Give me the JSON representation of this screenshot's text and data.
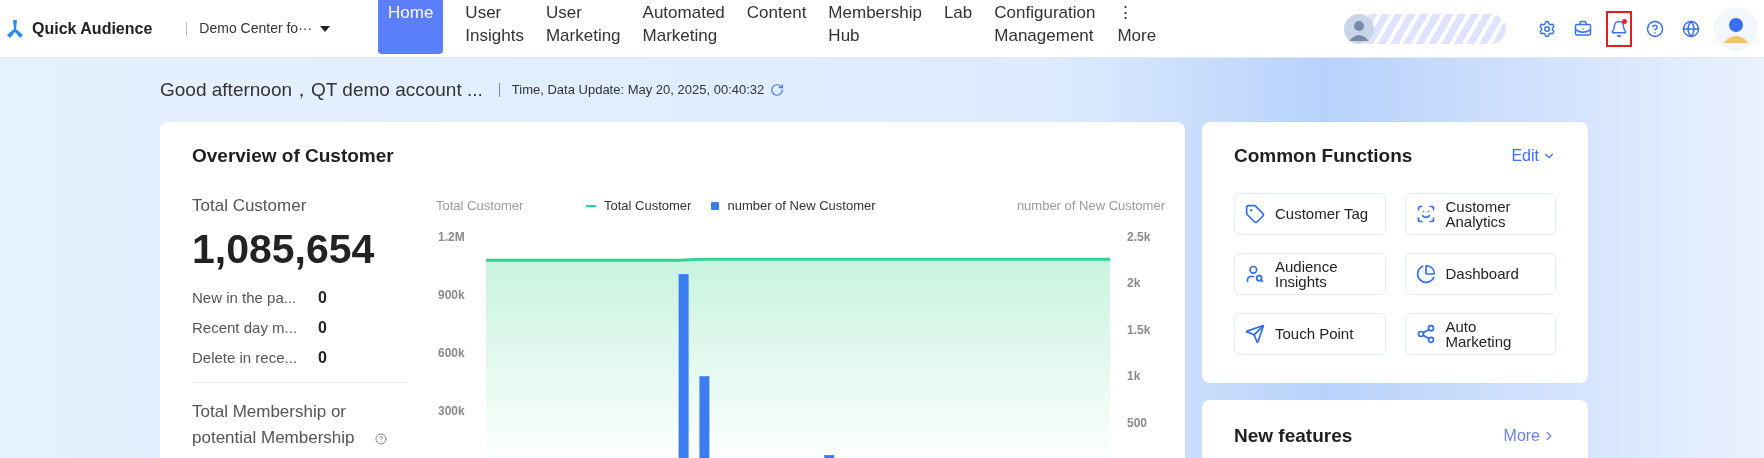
{
  "app": {
    "name": "Quick Audience"
  },
  "workspace": {
    "label": "Demo Center fo···"
  },
  "nav": [
    {
      "label": "Home",
      "selected": true
    },
    {
      "label": "User Insights",
      "selected": false
    },
    {
      "label": "User Marketing",
      "selected": false
    },
    {
      "label": "Automated Marketing",
      "selected": false
    },
    {
      "label": "Content",
      "selected": false
    },
    {
      "label": "Membership Hub",
      "selected": false
    },
    {
      "label": "Lab",
      "selected": false
    },
    {
      "label": "Configuration Management",
      "selected": false
    },
    {
      "label": "More",
      "selected": false,
      "glyph": "⋮"
    }
  ],
  "header_icons": [
    {
      "kind": "settings",
      "highlighted": false,
      "badge": false
    },
    {
      "kind": "briefcase",
      "highlighted": false,
      "badge": false
    },
    {
      "kind": "bell",
      "highlighted": true,
      "badge": true
    },
    {
      "kind": "help",
      "highlighted": false,
      "badge": false
    },
    {
      "kind": "globe",
      "highlighted": false,
      "badge": false
    }
  ],
  "greeting": "Good afternoon，QT demo account ...",
  "update_time": "Time, Data Update: May 20, 2025, 00:40:32",
  "overview": {
    "title": "Overview of Customer",
    "total_label": "Total Customer",
    "total_value": "1,085,654",
    "stats": [
      {
        "label": "New in the pa...",
        "value": "0"
      },
      {
        "label": "Recent day m...",
        "value": "0"
      },
      {
        "label": "Delete in rece...",
        "value": "0"
      }
    ],
    "membership_label": "Total Membership or potential Membership",
    "chart_data": {
      "type": "bar",
      "legend": "top",
      "ylabel": "Total Customer",
      "y2label": "number of New Customer",
      "ylim": [
        0,
        1200000
      ],
      "yticks": [
        {
          "value": 300000,
          "label": "300k"
        },
        {
          "value": 600000,
          "label": "600k"
        },
        {
          "value": 900000,
          "label": "900k"
        },
        {
          "value": 1200000,
          "label": "1.2M"
        }
      ],
      "y2lim": [
        0,
        2500
      ],
      "y2ticks": [
        {
          "value": 500,
          "label": "500"
        },
        {
          "value": 1000,
          "label": "1k"
        },
        {
          "value": 1500,
          "label": "1.5k"
        },
        {
          "value": 2000,
          "label": "2k"
        },
        {
          "value": 2500,
          "label": "2.5k"
        }
      ],
      "series": [
        {
          "name": "Total Customer",
          "color": "#2fd592",
          "type": "line",
          "values": [
            1080000,
            1080000,
            1080000,
            1080000,
            1080000,
            1080000,
            1080000,
            1080000,
            1080000,
            1080000,
            1085000,
            1085000,
            1085000,
            1085000,
            1085000,
            1085000,
            1085000,
            1085000,
            1085000,
            1085000,
            1085000,
            1085000,
            1085000,
            1085000,
            1085000,
            1085000,
            1085000,
            1085000,
            1085000,
            1085000
          ]
        },
        {
          "name": "number of New Customer",
          "color": "#3b7df0",
          "type": "bar",
          "axis": "y2",
          "values": [
            0,
            0,
            0,
            0,
            0,
            0,
            0,
            0,
            0,
            2100,
            1000,
            0,
            0,
            0,
            0,
            0,
            150,
            0,
            0,
            0,
            0,
            0,
            0,
            0,
            0,
            0,
            0,
            0,
            0,
            0
          ]
        }
      ]
    }
  },
  "common_functions": {
    "title": "Common Functions",
    "edit_label": "Edit",
    "items": [
      {
        "label": "Customer Tag",
        "kind": "tag"
      },
      {
        "label": "Customer Analytics",
        "kind": "analytics"
      },
      {
        "label": "Audience Insights",
        "kind": "insights"
      },
      {
        "label": "Dashboard",
        "kind": "dashboard"
      },
      {
        "label": "Touch Point",
        "kind": "touch"
      },
      {
        "label": "Auto Marketing",
        "kind": "auto"
      }
    ]
  },
  "new_features": {
    "title": "New features",
    "more_label": "More"
  }
}
